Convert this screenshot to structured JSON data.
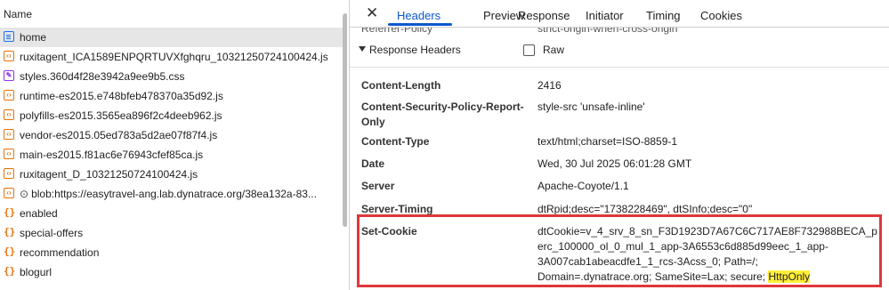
{
  "request_list": {
    "column_header": "Name",
    "items": [
      {
        "label": "home",
        "icon": "document-icon",
        "selected": true
      },
      {
        "label": "ruxitagent_ICA1589ENPQRTUVXfghqru_10321250724100424.js",
        "icon": "script-icon"
      },
      {
        "label": "styles.360d4f28e3942a9ee9b5.css",
        "icon": "stylesheet-icon"
      },
      {
        "label": "runtime-es2015.e748bfeb478370a35d92.js",
        "icon": "script-icon"
      },
      {
        "label": "polyfills-es2015.3565ea896f2c4deeb962.js",
        "icon": "script-icon"
      },
      {
        "label": "vendor-es2015.05ed783a5d2ae07f87f4.js",
        "icon": "script-icon"
      },
      {
        "label": "main-es2015.f81ac6e76943cfef85ca.js",
        "icon": "script-icon"
      },
      {
        "label": "ruxitagent_D_10321250724100424.js",
        "icon": "script-icon"
      },
      {
        "label": "blob:https://easytravel-ang.lab.dynatrace.org/38ea132a-83...",
        "icon": "script-icon",
        "prefix_symbol": "⊙"
      },
      {
        "label": "enabled",
        "icon": "fetch-icon"
      },
      {
        "label": "special-offers",
        "icon": "fetch-icon"
      },
      {
        "label": "recommendation",
        "icon": "fetch-icon"
      },
      {
        "label": "blogurl",
        "icon": "fetch-icon"
      }
    ]
  },
  "detail": {
    "close_icon": "close-icon",
    "tabs": [
      "Headers",
      "Preview",
      "Response",
      "Initiator",
      "Timing",
      "Cookies"
    ],
    "active_tab": "Headers",
    "partial_row": {
      "name": "Referrer-Policy",
      "value": "strict-origin-when-cross-origin"
    },
    "section_title": "Response Headers",
    "raw_label": "Raw",
    "raw_checked": false,
    "headers": [
      {
        "name": "Content-Length",
        "value": "2416"
      },
      {
        "name_line1": "Content-Security-Policy-Report-",
        "name_line2": "Only",
        "value": "style-src 'unsafe-inline'"
      },
      {
        "name": "Content-Type",
        "value": "text/html;charset=ISO-8859-1"
      },
      {
        "name": "Date",
        "value": "Wed, 30 Jul 2025 06:01:28 GMT"
      },
      {
        "name": "Server",
        "value": "Apache-Coyote/1.1"
      },
      {
        "name": "Server-Timing",
        "value": "dtRpid;desc=\"1738228469\", dtSInfo;desc=\"0\""
      }
    ],
    "set_cookie": {
      "name": "Set-Cookie",
      "line1": "dtCookie=v_4_srv_8_sn_F3D1923D7A67C6C717AE8F732988BECA_p",
      "line2": "erc_100000_ol_0_mul_1_app-3A6553c6d885d99eec_1_app-",
      "line3": "3A007cab1abeacdfe1_1_rcs-3Acss_0; Path=/;",
      "line4_prefix": "Domain=.dynatrace.org; SameSite=Lax; secure; ",
      "line4_highlight": "HttpOnly"
    },
    "colors": {
      "accent": "#0b57d0",
      "highlight_border": "#e0373a",
      "highlight_fill": "#ffef3a"
    }
  }
}
